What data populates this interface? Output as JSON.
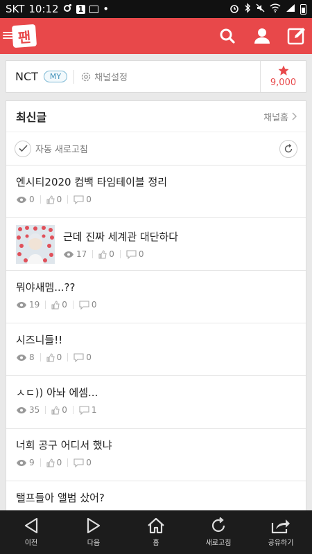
{
  "status_bar": {
    "carrier": "SKT",
    "time": "10:12",
    "badge": "1"
  },
  "app": {
    "logo_text": "팬"
  },
  "channel": {
    "name": "NCT",
    "my_badge": "MY",
    "settings_label": "채널설정",
    "star_count": "9,000"
  },
  "list": {
    "title": "최신글",
    "home_label": "채널홈",
    "auto_refresh_label": "자동 새로고침",
    "posts": [
      {
        "title": "엔시티2020 컴백 타임테이블 정리",
        "views": "0",
        "likes": "0",
        "comments": "0",
        "has_thumb": false
      },
      {
        "title": "근데 진짜 세계관 대단하다",
        "views": "17",
        "likes": "0",
        "comments": "0",
        "has_thumb": true
      },
      {
        "title": "뭐야새멤...??",
        "views": "19",
        "likes": "0",
        "comments": "0",
        "has_thumb": false
      },
      {
        "title": "시즈니들!!",
        "views": "8",
        "likes": "0",
        "comments": "0",
        "has_thumb": false
      },
      {
        "title": "ㅅㄷ)) 아놔 에셈...",
        "views": "35",
        "likes": "0",
        "comments": "1",
        "has_thumb": false
      },
      {
        "title": "너희 공구 어디서 했냐",
        "views": "9",
        "likes": "0",
        "comments": "0",
        "has_thumb": false
      },
      {
        "title": "탤프들아 앨범 샀어?",
        "views": "",
        "likes": "",
        "comments": "",
        "has_thumb": false
      }
    ]
  },
  "bottom_nav": [
    {
      "label": "이전",
      "icon": "back-triangle-icon"
    },
    {
      "label": "다음",
      "icon": "forward-triangle-icon"
    },
    {
      "label": "홈",
      "icon": "home-icon"
    },
    {
      "label": "새로고침",
      "icon": "refresh-icon"
    },
    {
      "label": "공유하기",
      "icon": "share-icon"
    }
  ],
  "colors": {
    "brand": "#e8484a",
    "nav_bg": "#1c1c1c"
  }
}
